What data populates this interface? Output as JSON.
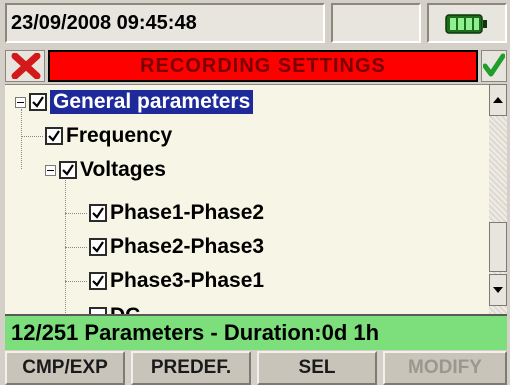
{
  "status": {
    "datetime": "23/09/2008 09:45:48",
    "battery_icon": "battery-icon"
  },
  "title_bar": {
    "title": "RECORDING SETTINGS",
    "close_icon": "close-icon",
    "confirm_icon": "checkmark-icon"
  },
  "tree": {
    "items": [
      {
        "label": "General parameters",
        "checked": true,
        "expander": true,
        "selected": true
      },
      {
        "label": "Frequency",
        "checked": true
      },
      {
        "label": "Voltages",
        "checked": true,
        "expander": true
      },
      {
        "label": "Phase1-Phase2",
        "checked": true
      },
      {
        "label": "Phase2-Phase3",
        "checked": true
      },
      {
        "label": "Phase3-Phase1",
        "checked": true
      },
      {
        "label": "DC",
        "checked": false
      }
    ]
  },
  "info_bar": {
    "text": "12/251 Parameters - Duration:0d 1h"
  },
  "function_keys": [
    {
      "label": "CMP/EXP",
      "enabled": true
    },
    {
      "label": "PREDEF.",
      "enabled": true
    },
    {
      "label": "SEL",
      "enabled": true
    },
    {
      "label": "MODIFY",
      "enabled": false
    }
  ],
  "colors": {
    "title_red": "#ff0000",
    "info_green": "#7cdf7c",
    "selection_blue": "#1f2a9a",
    "check_green": "#1f9e2a"
  }
}
